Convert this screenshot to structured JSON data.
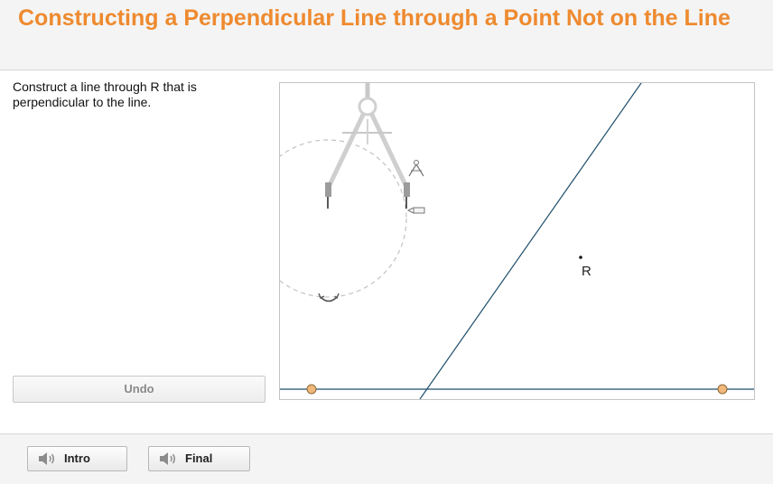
{
  "header": {
    "title": "Constructing a Perpendicular Line through a Point Not on the Line"
  },
  "instructions": "Construct a line through R that is perpendicular to the line.",
  "controls": {
    "undo_label": "Undo"
  },
  "canvas": {
    "point_label": "R",
    "tool_icons": [
      "compass-icon",
      "pencil-icon",
      "rotate-arrow-icon"
    ],
    "colors": {
      "line": "#1f4e6b",
      "handle_fill": "#f2b77a",
      "handle_stroke": "#8a6a3a"
    }
  },
  "footer": {
    "intro_label": "Intro",
    "final_label": "Final",
    "icon": "speaker-icon"
  }
}
